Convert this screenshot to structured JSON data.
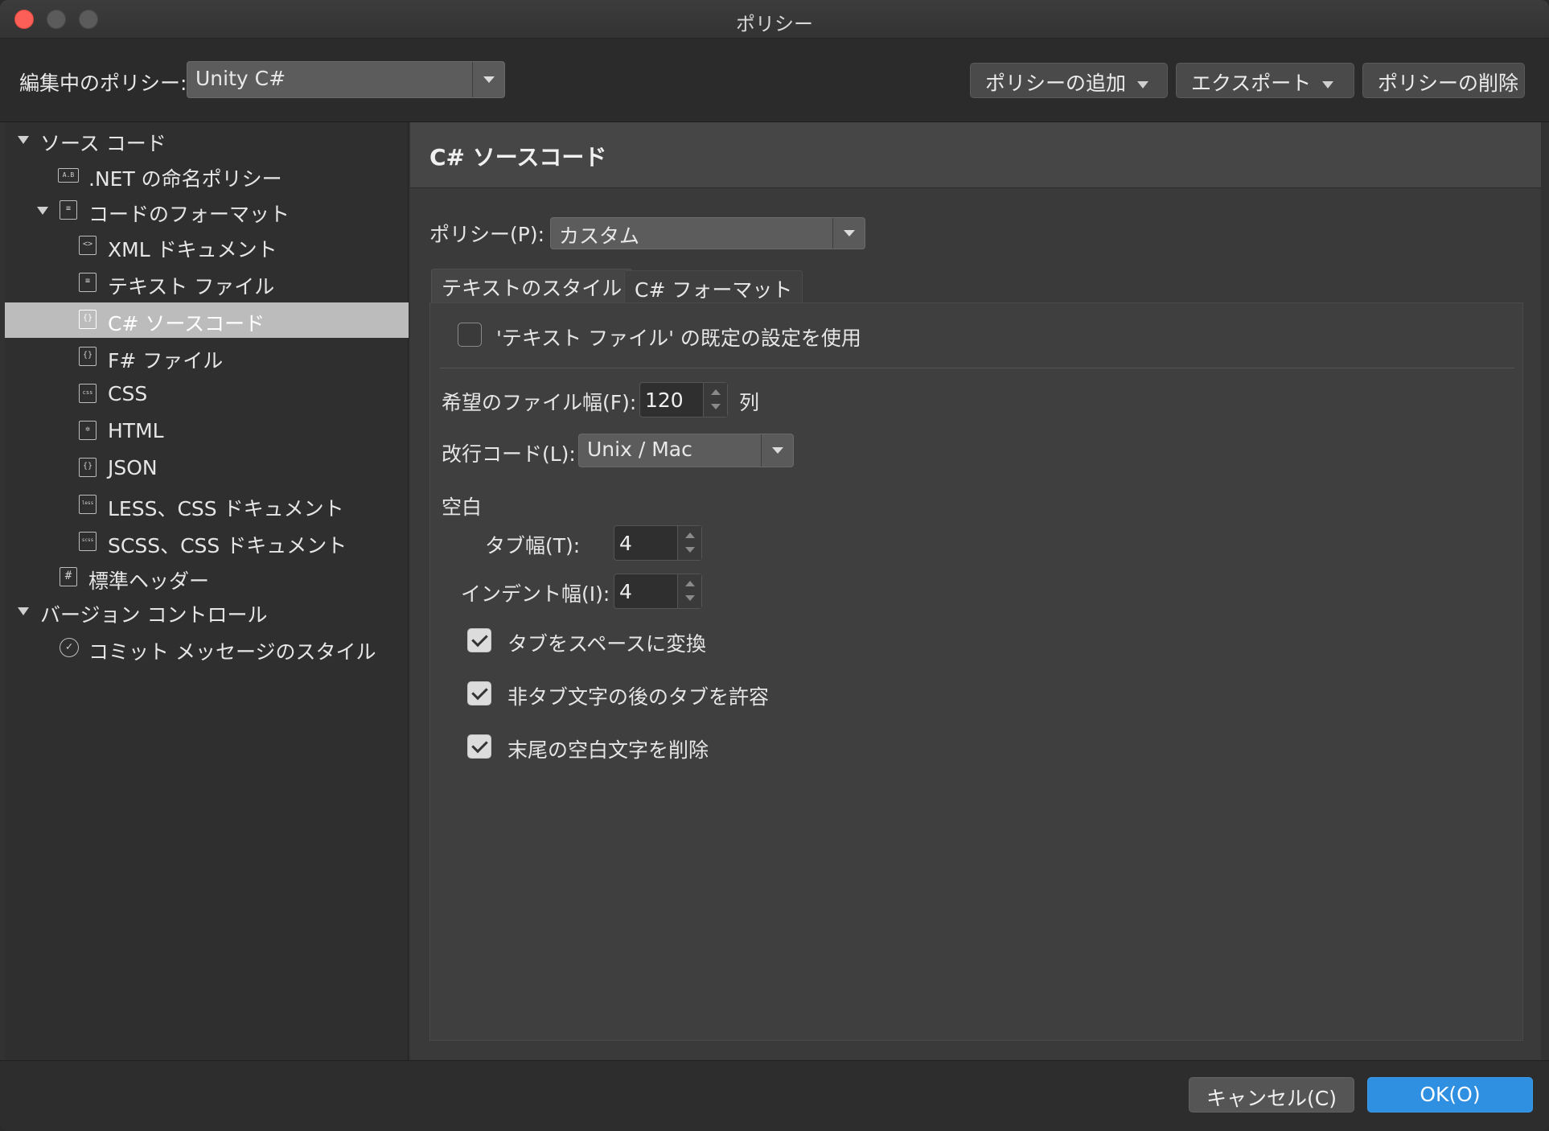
{
  "window": {
    "title": "ポリシー"
  },
  "toolbar": {
    "editing_label": "編集中のポリシー:",
    "editing_value": "Unity C#",
    "add_policy": "ポリシーの追加",
    "export": "エクスポート",
    "delete_policy": "ポリシーの削除"
  },
  "sidebar": {
    "source_code": "ソース コード",
    "net_naming": ".NET の命名ポリシー",
    "code_format": "コードのフォーマット",
    "xml_doc": "XML ドキュメント",
    "text_file": "テキスト ファイル",
    "csharp_source": "C# ソースコード",
    "fsharp_file": "F# ファイル",
    "css": "CSS",
    "html": "HTML",
    "json": "JSON",
    "less": "LESS、CSS ドキュメント",
    "scss": "SCSS、CSS ドキュメント",
    "std_header": "標準ヘッダー",
    "version_control": "バージョン コントロール",
    "commit_style": "コミット メッセージのスタイル"
  },
  "icons": {
    "net_naming": "A.B",
    "code_format": "≡",
    "xml_doc": "<>",
    "text_file": "≡",
    "csharp_source": "{}",
    "fsharp_file": "{}",
    "css": "css",
    "html": "✲",
    "json": "{}",
    "less": "less",
    "scss": "scss",
    "std_header": "#",
    "commit_style": "✓"
  },
  "main": {
    "header_title": "C# ソースコード",
    "policy_label": "ポリシー(P):",
    "policy_value": "カスタム",
    "tab_text_style": "テキストのスタイル",
    "tab_csharp_format": "C# フォーマット",
    "use_default_label": "'テキスト ファイル' の既定の設定を使用",
    "file_width_label": "希望のファイル幅(F):",
    "file_width_value": "120",
    "file_width_unit": "列",
    "eol_label": "改行コード(L):",
    "eol_value": "Unix / Mac",
    "whitespace_heading": "空白",
    "tab_width_label": "タブ幅(T):",
    "tab_width_value": "4",
    "indent_width_label": "インデント幅(I):",
    "indent_width_value": "4",
    "convert_tabs_label": "タブをスペースに変換",
    "allow_tabs_label": "非タブ文字の後のタブを許容",
    "remove_trailing_label": "末尾の空白文字を削除"
  },
  "checkboxes": {
    "use_default": false,
    "convert_tabs": true,
    "allow_tabs": true,
    "remove_trailing": true
  },
  "footer": {
    "cancel": "キャンセル(C)",
    "ok": "OK(O)"
  },
  "colors": {
    "accent": "#2f8fe0",
    "close": "#fc5f57",
    "selection": "#bcbcbc"
  }
}
